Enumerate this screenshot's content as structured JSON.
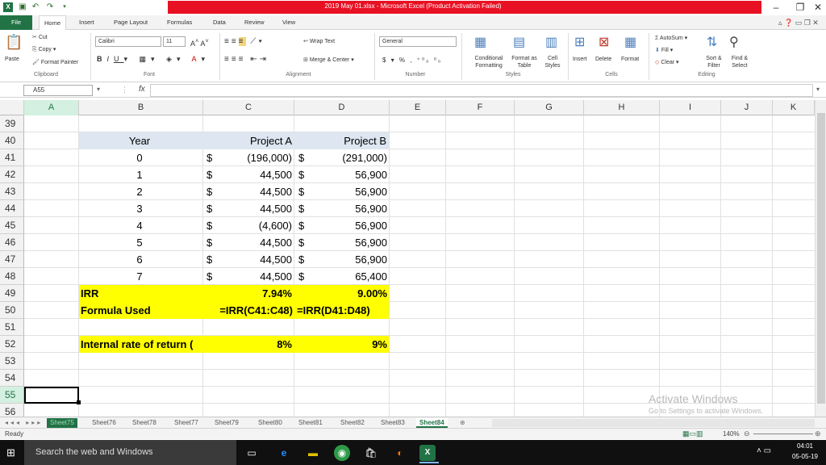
{
  "window": {
    "title": "2019 May 01.xlsx - Microsoft Excel (Product Activation Failed)"
  },
  "tabs": [
    "File",
    "Home",
    "Insert",
    "Page Layout",
    "Formulas",
    "Data",
    "Review",
    "View"
  ],
  "ribbon": {
    "clipboard": {
      "cut": "Cut",
      "copy": "Copy",
      "paste": "Paste",
      "format_painter": "Format Painter",
      "label": "Clipboard"
    },
    "font": {
      "name": "Calibri",
      "size": "11",
      "label": "Font"
    },
    "alignment": {
      "wrap": "Wrap Text",
      "merge": "Merge & Center",
      "label": "Alignment"
    },
    "number": {
      "format": "General",
      "currency": "$",
      "percent": "%",
      "comma": ",",
      "label": "Number"
    },
    "styles": {
      "conditional": "Conditional Formatting",
      "format_table": "Format as Table",
      "cell_styles": "Cell Styles",
      "label": "Styles"
    },
    "cells": {
      "insert": "Insert",
      "delete": "Delete",
      "format": "Format",
      "label": "Cells"
    },
    "editing": {
      "autosum": "AutoSum",
      "fill": "Fill",
      "clear": "Clear",
      "sort": "Sort & Filter",
      "find": "Find & Select",
      "label": "Editing"
    }
  },
  "formula_bar": {
    "name_box": "A55",
    "fx": "fx",
    "value": ""
  },
  "columns": [
    "A",
    "B",
    "C",
    "D",
    "E",
    "F",
    "G",
    "H",
    "I",
    "J",
    "K"
  ],
  "rows": [
    "39",
    "40",
    "41",
    "42",
    "43",
    "44",
    "45",
    "46",
    "47",
    "48",
    "49",
    "50",
    "51",
    "52",
    "53",
    "54",
    "55",
    "56"
  ],
  "table": {
    "headers": {
      "year": "Year",
      "a": "Project A",
      "b": "Project B"
    },
    "years": [
      "0",
      "1",
      "2",
      "3",
      "4",
      "5",
      "6",
      "7"
    ],
    "a_vals": [
      "(196,000)",
      "44,500",
      "44,500",
      "44,500",
      "(4,600)",
      "44,500",
      "44,500",
      "44,500"
    ],
    "b_vals": [
      "(291,000)",
      "56,900",
      "56,900",
      "56,900",
      "56,900",
      "56,900",
      "56,900",
      "65,400"
    ],
    "dollar": "$",
    "irr_label": "IRR",
    "irr_a": "7.94%",
    "irr_b": "9.00%",
    "formula_label": "Formula Used",
    "formula_a": "=IRR(C41:C48)",
    "formula_b": "=IRR(D41:D48)",
    "irr2_label": "Internal rate of return (",
    "irr2_a": "8%",
    "irr2_b": "9%"
  },
  "sheets": [
    "Sheet75",
    "Sheet76",
    "Sheet78",
    "Sheet77",
    "Sheet79",
    "Sheet80",
    "Sheet81",
    "Sheet82",
    "Sheet83",
    "Sheet84"
  ],
  "active_sheet": "Sheet84",
  "watermark": {
    "line1": "Activate Windows",
    "line2": "Go to Settings to activate Windows."
  },
  "status": {
    "ready": "Ready",
    "zoom": "140%"
  },
  "taskbar": {
    "search": "Search the web and Windows",
    "time": "04:01",
    "date": "05-05-19"
  },
  "colors": {
    "excel_green": "#217346",
    "highlight": "#ffff00",
    "header_fill": "#dde6f1",
    "titlebar_red": "#e81123"
  }
}
